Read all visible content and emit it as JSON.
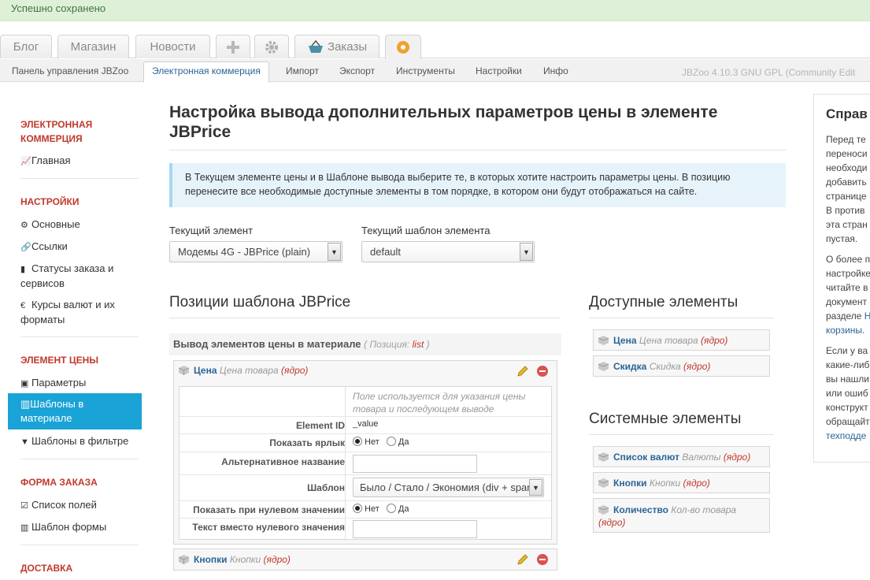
{
  "status": {
    "message": "Успешно сохранено"
  },
  "top_tabs": [
    {
      "label": "Блог"
    },
    {
      "label": "Магазин"
    },
    {
      "label": "Новости"
    },
    {
      "label": "",
      "icon": "plus-icon"
    },
    {
      "label": "",
      "icon": "gear-icon"
    },
    {
      "label": "Заказы",
      "icon": "basket-icon"
    },
    {
      "label": "",
      "icon": "jbzoo-logo-icon"
    }
  ],
  "subnav": {
    "items": [
      "Панель управления JBZoo",
      "Электронная коммерция",
      "Импорт",
      "Экспорт",
      "Инструменты",
      "Настройки",
      "Инфо"
    ],
    "active": "Электронная коммерция",
    "version": "JBZoo 4.10.3 GNU GPL (Community Edit"
  },
  "sidebar": {
    "section1": {
      "title_line1": "ЭЛЕКТРОННАЯ",
      "title_line2": "КОММЕРЦИЯ",
      "items": [
        "Главная"
      ]
    },
    "section2": {
      "title": "НАСТРОЙКИ",
      "items": [
        "Основные",
        "Ссылки",
        "Статусы заказа и",
        "сервисов",
        "Курсы валют и их",
        "форматы"
      ]
    },
    "section3": {
      "title": "ЭЛЕМЕНТ ЦЕНЫ",
      "items": [
        "Параметры",
        "Шаблоны в",
        "материале",
        "Шаблоны в фильтре"
      ]
    },
    "section4": {
      "title": "ФОРМА ЗАКАЗА",
      "items": [
        "Список полей",
        "Шаблон формы"
      ]
    },
    "section5": {
      "title": "ДОСТАВКА"
    }
  },
  "main": {
    "title_line1": "Настройка вывода дополнительных параметров цены в элементе",
    "title_line2": "JBPrice",
    "info_line1": "В Текущем элементе цены и в Шаблоне вывода выберите те, в которых хотите настроить параметры цены. В позицию",
    "info_line2": "перенесите все необходимые доступные элементы в том порядке, в котором они будут отображаться на сайте.",
    "current_element_label": "Текущий элемент",
    "current_element_value": "Модемы 4G - JBPrice (plain)",
    "current_template_label": "Текущий шаблон элемента",
    "current_template_value": "default"
  },
  "positions": {
    "heading": "Позиции шаблона JBPrice",
    "block_title": "Вывод элементов цены в материале",
    "block_pos_label": "( Позиция:",
    "block_pos_value": "list",
    "block_pos_close": ")",
    "element1": {
      "name": "Цена",
      "desc": "Цена товара",
      "core": "(ядро)"
    },
    "element1_hint_line1": "Поле используется для указания цены",
    "element1_hint_line2": "товара и последующем выводе",
    "params": {
      "element_id_label": "Element ID",
      "element_id_value": "_value",
      "show_label_label": "Показать ярлык",
      "no": "Нет",
      "yes": "Да",
      "alt_name_label": "Альтернативное название",
      "template_label": "Шаблон",
      "template_value": "Было / Стало / Экономия (div + span)",
      "show_zero_label": "Показать при нулевом значении",
      "text_zero_label": "Текст вместо нулевого значения"
    },
    "element2": {
      "name": "Кнопки",
      "desc": "Кнопки",
      "core": "(ядро)"
    }
  },
  "available": {
    "heading": "Доступные элементы",
    "items": [
      {
        "name": "Цена",
        "desc": "Цена товара",
        "core": "(ядро)"
      },
      {
        "name": "Скидка",
        "desc": "Скидка",
        "core": "(ядро)"
      }
    ]
  },
  "system": {
    "heading": "Системные элементы",
    "items": [
      {
        "name": "Список валют",
        "desc": "Валюты",
        "core": "(ядро)"
      },
      {
        "name": "Кнопки",
        "desc": "Кнопки",
        "core": "(ядро)"
      },
      {
        "name": "Количество",
        "desc": "Кол-во товара",
        "core": "(ядро)"
      }
    ]
  },
  "help": {
    "title": "Справ",
    "p1": [
      "Перед те",
      "переноси",
      "необходи",
      "добавить",
      "странице",
      "В против",
      "эта стран",
      "пустая."
    ],
    "p2": [
      "О более п",
      "настройке",
      "читайте в",
      "документ",
      "разделе",
      "корзины."
    ],
    "p2_link_frag": "Н",
    "p3": [
      "Если у ва",
      "какие-либ",
      "вы нашли",
      "или ошиб",
      "конструкт",
      "обращайт"
    ],
    "p3_link": "техподде"
  },
  "colors": {
    "accent": "#1aa3d6",
    "link": "#2a6496",
    "section_red": "#c0392b",
    "success_bg": "#dff0d8"
  }
}
